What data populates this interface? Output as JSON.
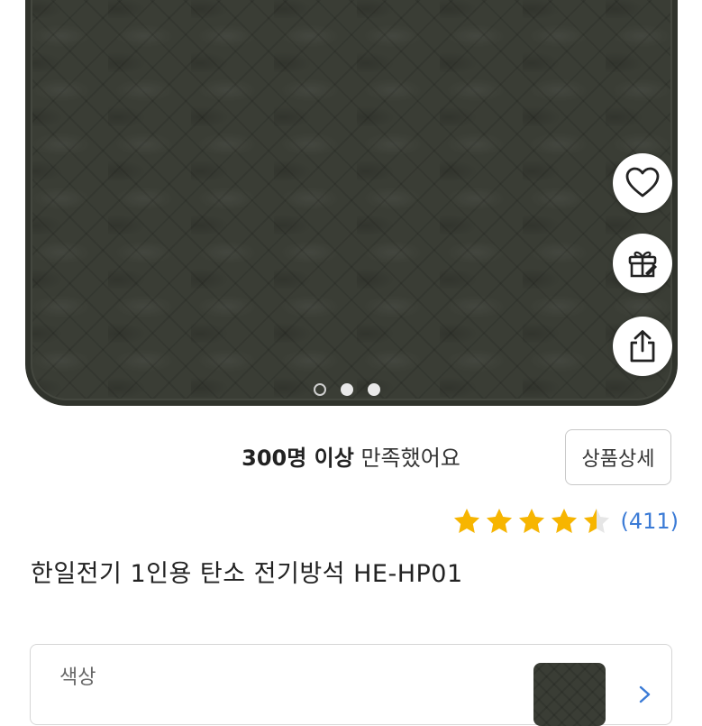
{
  "product_image": {
    "page_count": 3,
    "active_index": 2
  },
  "actions": {
    "like_icon": "heart-icon",
    "gift_icon": "gift-icon",
    "share_icon": "share-icon"
  },
  "satisfaction": {
    "strong": "300명 이상",
    "rest": " 만족했어요"
  },
  "detail_button_label": "상품상세",
  "rating": {
    "value": 4.5,
    "max": 5,
    "count_label": "(411)",
    "star_color": "#f7b500"
  },
  "product_title": "한일전기 1인용 탄소 전기방석 HE-HP01",
  "option": {
    "label": "색상"
  },
  "colors": {
    "accent_link": "#3b7bd6"
  }
}
